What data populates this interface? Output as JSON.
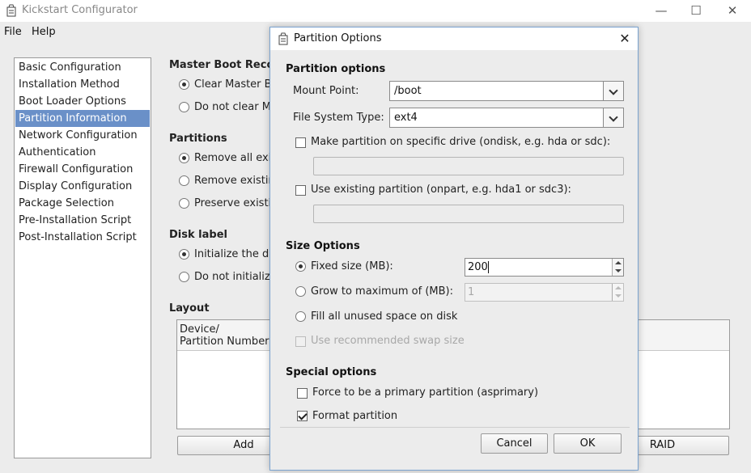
{
  "window": {
    "title": "Kickstart Configurator",
    "controls": {
      "minimize": "—",
      "maximize": "☐",
      "close": "✕"
    }
  },
  "menu": {
    "file": "File",
    "help": "Help"
  },
  "nav": {
    "items": [
      "Basic Configuration",
      "Installation Method",
      "Boot Loader Options",
      "Partition Information",
      "Network Configuration",
      "Authentication",
      "Firewall Configuration",
      "Display Configuration",
      "Package Selection",
      "Pre-Installation Script",
      "Post-Installation Script"
    ],
    "selected": "Partition Information"
  },
  "main": {
    "mbr": {
      "title": "Master Boot Reco",
      "opt1": "Clear Master B",
      "opt2": "Do not clear M"
    },
    "partitions": {
      "title": "Partitions",
      "opt1": "Remove all exis",
      "opt2": "Remove existin",
      "opt3": "Preserve existi"
    },
    "disklabel": {
      "title": "Disk label",
      "opt1": "Initialize the dis",
      "opt2": "Do not initialize"
    },
    "layout": {
      "title": "Layout",
      "col_device_line1": "Device/",
      "col_device_line2": "Partition Number"
    },
    "buttons": {
      "add": "Add",
      "raid": "RAID"
    }
  },
  "dialog": {
    "title": "Partition Options",
    "close": "✕",
    "partition_options": {
      "title": "Partition options",
      "mount_point_label": "Mount Point:",
      "mount_point_value": "/boot",
      "fs_type_label": "File System Type:",
      "fs_type_value": "ext4",
      "ondisk_label": "Make partition on specific drive (ondisk, e.g. hda or sdc):",
      "onpart_label": "Use existing partition (onpart, e.g. hda1 or sdc3):"
    },
    "size_options": {
      "title": "Size Options",
      "fixed_label": "Fixed size (MB):",
      "fixed_value": "200",
      "grow_label": "Grow to maximum of (MB):",
      "grow_value": "1",
      "fill_label": "Fill all unused space on disk",
      "swap_label": "Use recommended swap size"
    },
    "special_options": {
      "title": "Special options",
      "primary_label": "Force to be a primary partition (asprimary)",
      "format_label": "Format partition"
    },
    "buttons": {
      "cancel": "Cancel",
      "ok": "OK"
    }
  }
}
